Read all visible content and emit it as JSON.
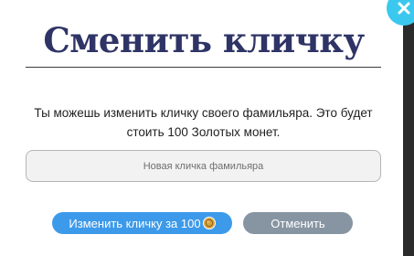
{
  "dialog": {
    "title": "Сменить кличку",
    "description": "Ты можешь изменить кличку своего фамильяра. Это будет стоить 100 Золотых монет.",
    "name_input": {
      "value": "",
      "placeholder": "Новая кличка фамильяра"
    },
    "buttons": {
      "change_label": "Изменить кличку за 100",
      "change_icon": "gold-coin-icon",
      "cancel_label": "Отменить"
    },
    "close_icon": "close-icon"
  },
  "colors": {
    "title": "#2f3466",
    "primary_button": "#3d9aea",
    "secondary_button": "#8795a3",
    "close_button": "#3bc8ee",
    "coin": "#d9a441"
  }
}
